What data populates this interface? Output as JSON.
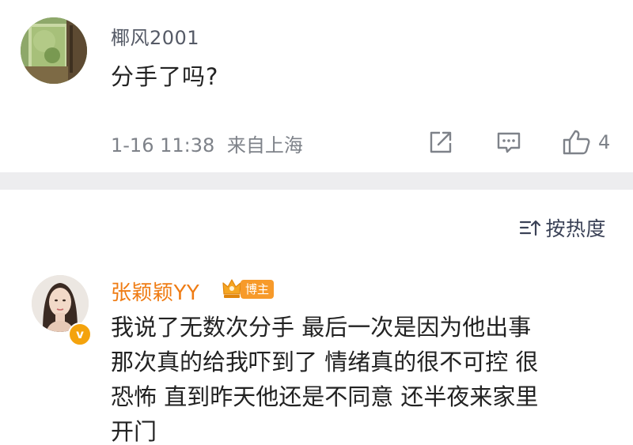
{
  "comment_1": {
    "username": "椰风2001",
    "text": "分手了吗?",
    "timestamp": "1-16 11:38",
    "location": "来自上海",
    "like_count": "4",
    "icons": [
      "share-icon",
      "comment-icon",
      "like-icon"
    ]
  },
  "sort": {
    "label": "按热度",
    "icon": "sort-icon"
  },
  "comment_2": {
    "username": "张颖颖YY",
    "badge": "博主",
    "text_lines": [
      "我说了无数次分手 最后一次是因为他出事",
      "那次真的给我吓到了 情绪真的很不可控 很",
      "恐怖  直到昨天他还是不同意 还半夜来家里",
      "开门"
    ],
    "verified_mark": "v"
  },
  "colors": {
    "username_orange": "#ef7c14",
    "meta_gray": "#7e8289",
    "divider": "#ededef",
    "badge_orange": "#f79a2a"
  }
}
